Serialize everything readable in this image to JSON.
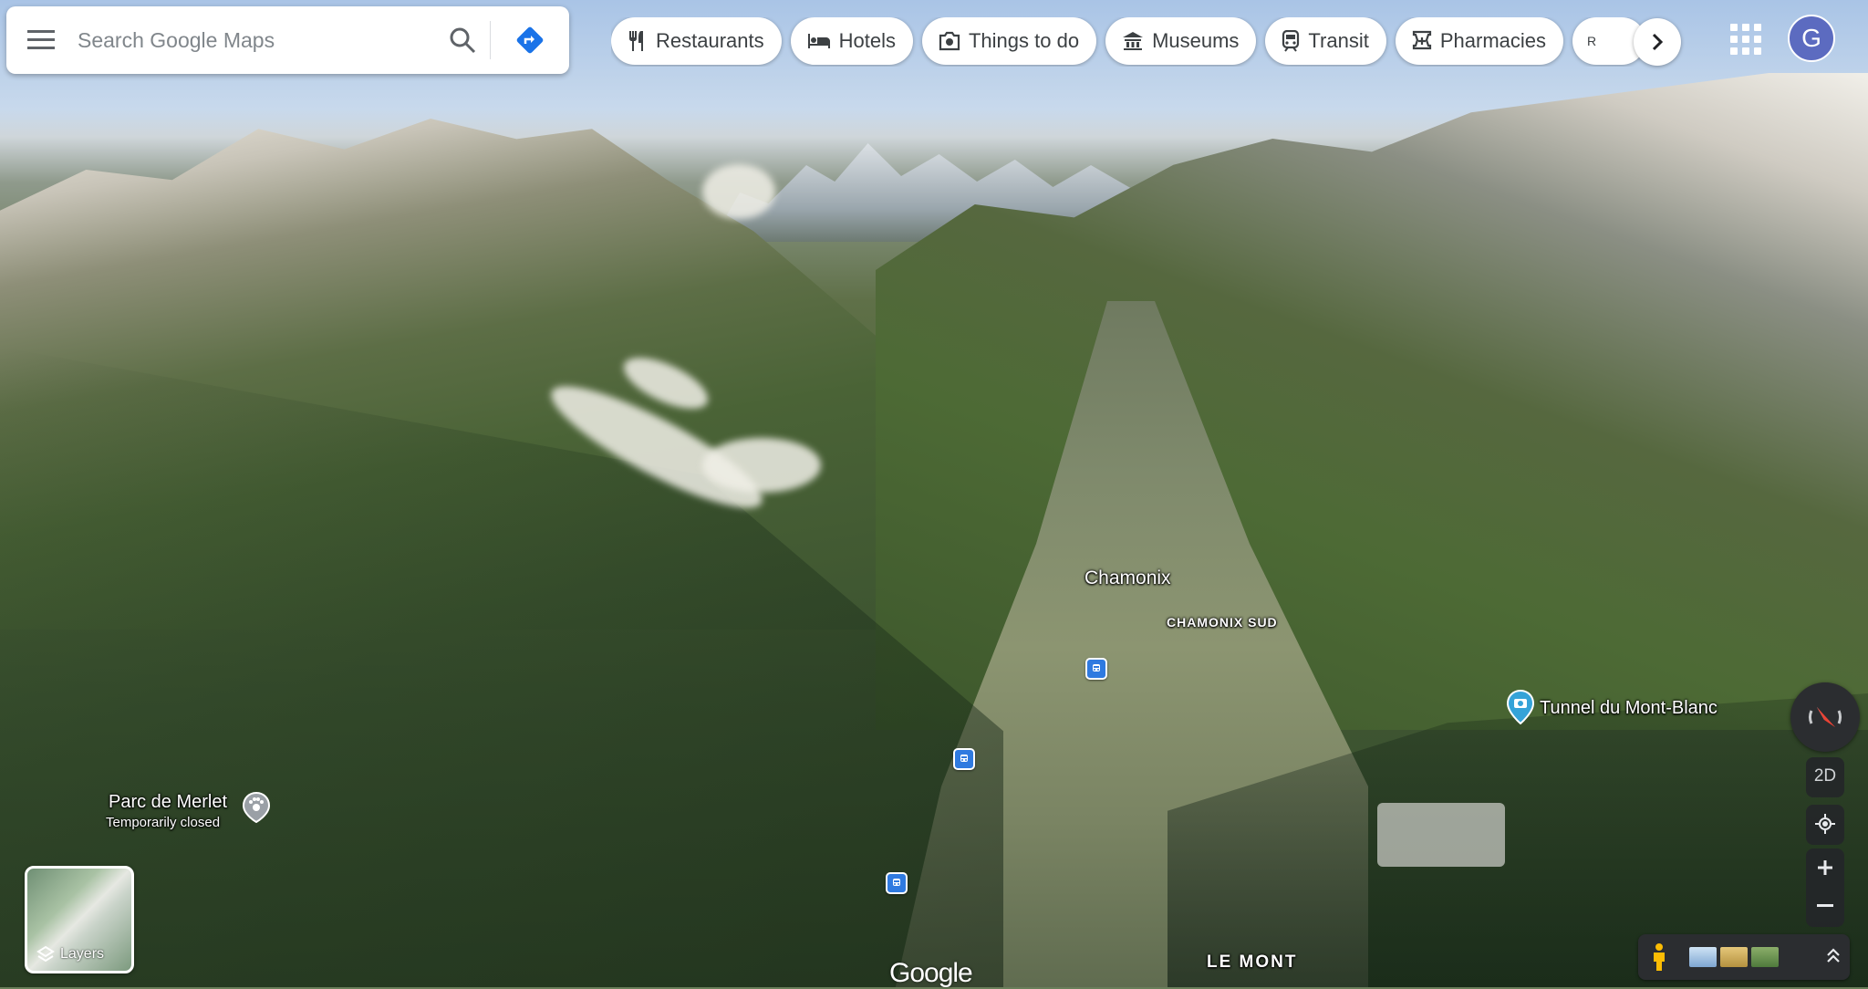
{
  "search": {
    "placeholder": "Search Google Maps",
    "menu_icon": "menu-icon",
    "search_icon": "search-icon",
    "directions_icon": "directions-icon"
  },
  "chips": [
    {
      "label": "Restaurants",
      "icon": "restaurant-icon"
    },
    {
      "label": "Hotels",
      "icon": "hotel-icon"
    },
    {
      "label": "Things to do",
      "icon": "camera-icon"
    },
    {
      "label": "Museums",
      "icon": "museum-icon"
    },
    {
      "label": "Transit",
      "icon": "transit-icon"
    },
    {
      "label": "Pharmacies",
      "icon": "pharmacy-icon"
    },
    {
      "label": "R",
      "icon": "atm-icon"
    }
  ],
  "account": {
    "initial": "G",
    "color": "#5c6bc0"
  },
  "map_labels": {
    "city": "Chamonix",
    "district": "CHAMONIX SUD",
    "poi_tunnel": "Tunnel du Mont-Blanc",
    "poi_park": "Parc de Merlet",
    "poi_park_status": "Temporarily closed",
    "region": "LE MONT"
  },
  "layers": {
    "label": "Layers"
  },
  "controls": {
    "view_mode": "2D"
  },
  "branding": {
    "logo": "Google"
  },
  "colors": {
    "transit_pin": "#2f7ae0",
    "poi_pin": "#35a3d8",
    "park_pin": "#9aa0a6",
    "directions": "#1a73e8"
  }
}
